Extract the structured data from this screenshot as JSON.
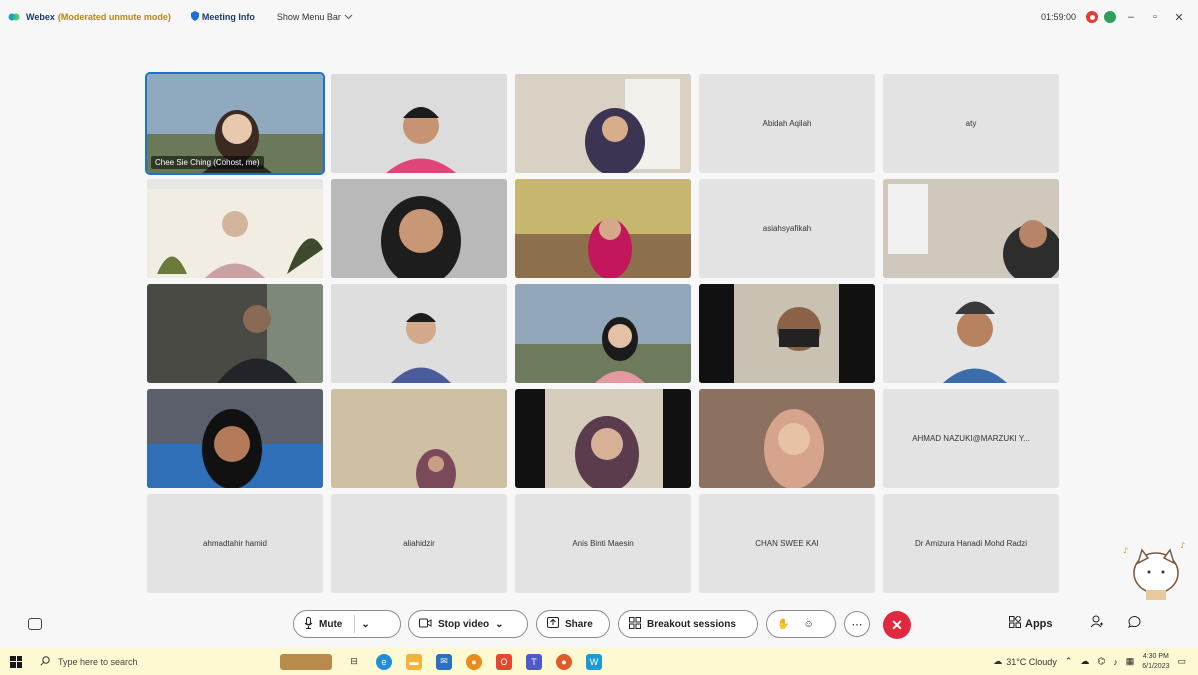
{
  "titlebar": {
    "app_name": "Webex",
    "mode": "(Moderated unmute mode)",
    "meeting_info": "Meeting Info",
    "show_menu_bar": "Show Menu Bar",
    "timer": "01:59:00"
  },
  "grid": {
    "self_label": "Chee Sie Ching (Cohost, me)",
    "named_tiles": {
      "t4": "Abidah Aqilah",
      "t5": "aty",
      "t9": "asiahsyafikah",
      "t20": "AHMAD NAZUKI@MARZUKI Y...",
      "t21": "ahmadtahir hamid",
      "t22": "aliahidzir",
      "t23": "Anis Binti Maesin",
      "t24": "CHAN SWEE KAI",
      "t25": "Dr Amizura Hanadi Mohd Radzi"
    }
  },
  "controls": {
    "mute": "Mute",
    "stop_video": "Stop video",
    "share": "Share",
    "breakout": "Breakout sessions",
    "apps": "Apps"
  },
  "taskbar": {
    "search_placeholder": "Type here to search",
    "weather": "31°C  Cloudy",
    "time": "4:30 PM",
    "date": "6/1/2023"
  },
  "colors": {
    "accent": "#1e6fd6",
    "leave": "#e0283e",
    "taskbar": "#fdf9d2"
  }
}
